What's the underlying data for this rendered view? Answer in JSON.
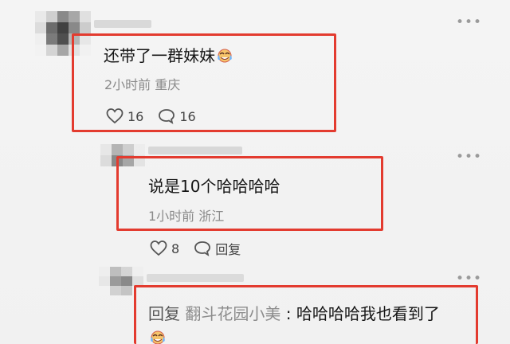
{
  "comments": [
    {
      "text": "还带了一群妹妹",
      "emoji": "crying-laughing-emoji",
      "meta": "2小时前 重庆",
      "likes": "16",
      "replies": "16"
    },
    {
      "text": "说是10个哈哈哈哈",
      "meta": "1小时前 浙江",
      "likes": "8",
      "reply_label": "回复"
    },
    {
      "reply_prefix": "回复",
      "reply_name": "翻斗花园小美",
      "reply_separator": ":",
      "text": "哈哈哈哈我也看到了",
      "emoji": "crying-laughing-emoji"
    }
  ],
  "colors": {
    "highlight": "#e33b2f",
    "text": "#151515",
    "meta": "#8a8a8a",
    "background": "#f3f3f3"
  },
  "icons": {
    "more": "more-options-icon",
    "like": "heart-icon",
    "comment": "comment-icon"
  }
}
